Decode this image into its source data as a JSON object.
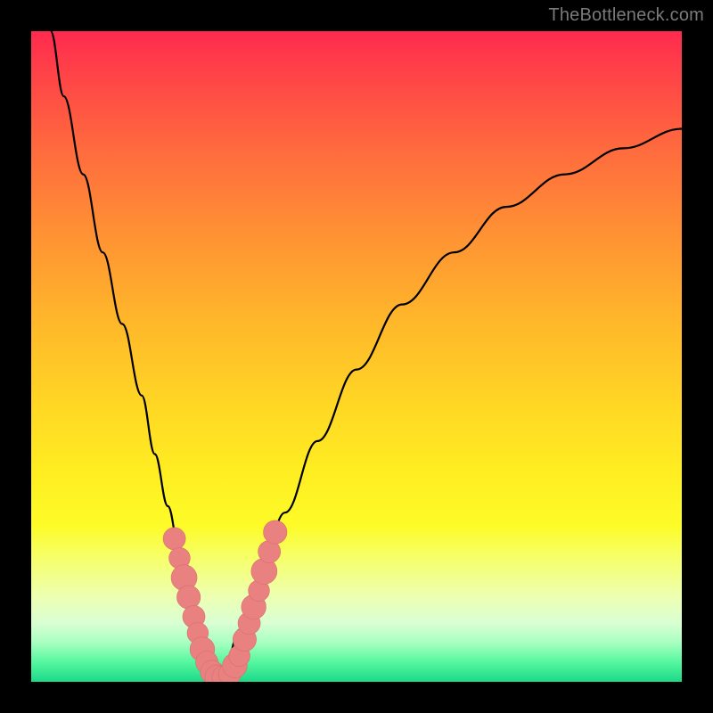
{
  "watermark": "TheBottleneck.com",
  "colors": {
    "frame": "#000000",
    "curve": "#000000",
    "marker_fill": "#e98181",
    "marker_stroke": "#d86f6f"
  },
  "chart_data": {
    "type": "line",
    "title": "",
    "xlabel": "",
    "ylabel": "",
    "xlim": [
      0,
      100
    ],
    "ylim": [
      0,
      100
    ],
    "grid": false,
    "legend": false,
    "note": "No numeric axis tick labels are visible; x and y values are approximate positions on a 0–100 scale read visually from the figure.",
    "background_gradient_stops": [
      {
        "pos": 0.0,
        "color": "#ff2a4f"
      },
      {
        "pos": 0.45,
        "color": "#ffb82a"
      },
      {
        "pos": 0.76,
        "color": "#fdfb28"
      },
      {
        "pos": 1.0,
        "color": "#1cd989"
      }
    ],
    "series": [
      {
        "name": "bottleneck-v-left",
        "x": [
          3,
          5,
          8,
          11,
          14,
          17,
          19,
          21,
          23,
          24.5,
          26,
          27.5,
          28.5
        ],
        "y": [
          100,
          90,
          78,
          66,
          55,
          44,
          35,
          27,
          19,
          12,
          7,
          3,
          0.5
        ]
      },
      {
        "name": "bottleneck-v-right",
        "x": [
          28.5,
          30,
          32,
          35,
          39,
          44,
          50,
          57,
          65,
          73,
          82,
          91,
          100
        ],
        "y": [
          0.5,
          3,
          8,
          16,
          26,
          37,
          48,
          58,
          66,
          73,
          78,
          82,
          85
        ]
      }
    ],
    "markers": [
      {
        "x": 22.0,
        "y": 22.0,
        "r": 1.3
      },
      {
        "x": 22.8,
        "y": 19.0,
        "r": 1.2
      },
      {
        "x": 23.5,
        "y": 16.0,
        "r": 1.6
      },
      {
        "x": 24.2,
        "y": 13.0,
        "r": 1.4
      },
      {
        "x": 25.0,
        "y": 10.0,
        "r": 1.3
      },
      {
        "x": 25.6,
        "y": 7.5,
        "r": 1.2
      },
      {
        "x": 26.3,
        "y": 5.0,
        "r": 1.5
      },
      {
        "x": 27.0,
        "y": 3.0,
        "r": 1.3
      },
      {
        "x": 27.8,
        "y": 1.5,
        "r": 1.4
      },
      {
        "x": 28.6,
        "y": 0.7,
        "r": 1.5
      },
      {
        "x": 29.6,
        "y": 0.7,
        "r": 1.4
      },
      {
        "x": 30.5,
        "y": 1.2,
        "r": 1.3
      },
      {
        "x": 31.3,
        "y": 2.5,
        "r": 1.5
      },
      {
        "x": 32.0,
        "y": 4.0,
        "r": 1.2
      },
      {
        "x": 32.8,
        "y": 6.5,
        "r": 1.4
      },
      {
        "x": 33.5,
        "y": 9.0,
        "r": 1.3
      },
      {
        "x": 34.2,
        "y": 11.5,
        "r": 1.5
      },
      {
        "x": 35.0,
        "y": 14.0,
        "r": 1.2
      },
      {
        "x": 35.8,
        "y": 17.0,
        "r": 1.6
      },
      {
        "x": 36.6,
        "y": 20.0,
        "r": 1.3
      },
      {
        "x": 37.5,
        "y": 23.0,
        "r": 1.4
      }
    ]
  }
}
